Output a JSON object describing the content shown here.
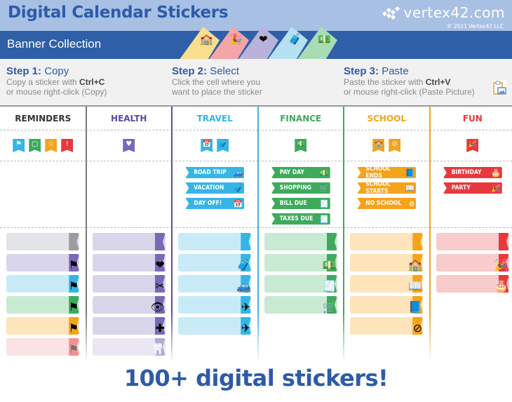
{
  "header": {
    "title": "Digital Calendar Stickers",
    "subtitle": "Banner Collection",
    "logo_text": "vertex42.com",
    "copyright": "© 2021 Vertex42 LLC",
    "tabs": [
      {
        "name": "school",
        "color": "#fadd8f",
        "corner": "#f4b400",
        "icon": "🏫"
      },
      {
        "name": "fun",
        "color": "#f3a5a7",
        "corner": "#e8383d",
        "icon": "🎉"
      },
      {
        "name": "health",
        "color": "#b9b3dc",
        "corner": "#7b68b8",
        "icon": "❤"
      },
      {
        "name": "travel",
        "color": "#b6e1f3",
        "corner": "#35b5e5",
        "icon": "🧳"
      },
      {
        "name": "finance",
        "color": "#a9dcb4",
        "corner": "#3eaa5c",
        "icon": "💵"
      }
    ]
  },
  "steps": [
    {
      "num": "Step 1:",
      "action": "Copy",
      "line1_pre": "Copy a sticker with ",
      "line1_key": "Ctrl+C",
      "line2": "or mouse right-click (Copy)"
    },
    {
      "num": "Step 2:",
      "action": "Select",
      "line1_pre": "Click the cell where you",
      "line1_key": "",
      "line2": "want to place the sticker"
    },
    {
      "num": "Step 3:",
      "action": "Paste",
      "line1_pre": "Paste the sticker with ",
      "line1_key": "Ctrl+V",
      "line2": "or mouse right-click (Paste Picture)"
    }
  ],
  "paste_icon": "paste-picture-icon",
  "columns": [
    {
      "name": "REMINDERS",
      "color": "#333333",
      "line_color": "#777777",
      "ribbons": [
        {
          "color": "#35b5e5",
          "icon": "⚑"
        },
        {
          "color": "#3eaa5c",
          "icon": "▢"
        },
        {
          "color": "#f5a31a",
          "icon": "☆"
        },
        {
          "color": "#e8383d",
          "icon": "!"
        }
      ],
      "labels": [],
      "banners": [
        {
          "bg": "#e2e4e8",
          "end": "#9a9ca0",
          "icon": ""
        },
        {
          "bg": "#d9d5ea",
          "end": "#7b68b8",
          "icon": "⚑"
        },
        {
          "bg": "#c9ebf8",
          "end": "#35b5e5",
          "icon": "⚑"
        },
        {
          "bg": "#c9ead2",
          "end": "#3eaa5c",
          "icon": "⚑"
        },
        {
          "bg": "#fde4bb",
          "end": "#f5a31a",
          "icon": "⚑"
        },
        {
          "bg": "#f8cccd",
          "end": "#e8383d",
          "icon": "⚑",
          "fade": true
        }
      ]
    },
    {
      "name": "HEALTH",
      "color": "#5b4ba0",
      "line_color": "#5b4ba0",
      "ribbons": [
        {
          "color": "#7b68b8",
          "icon": "♥"
        }
      ],
      "labels": [],
      "banners": [
        {
          "bg": "#d9d5ea",
          "end": "#7b68b8",
          "icon": ""
        },
        {
          "bg": "#d9d5ea",
          "end": "#7b68b8",
          "icon": "❤"
        },
        {
          "bg": "#d9d5ea",
          "end": "#7b68b8",
          "icon": "✂"
        },
        {
          "bg": "#d9d5ea",
          "end": "#7b68b8",
          "icon": "👁"
        },
        {
          "bg": "#d9d5ea",
          "end": "#7b68b8",
          "icon": "✚"
        },
        {
          "bg": "#d9d5ea",
          "end": "#7b68b8",
          "icon": "🦷",
          "fade": true
        }
      ]
    },
    {
      "name": "TRAVEL",
      "color": "#35b5e5",
      "line_color": "#35b5e5",
      "ribbons": [
        {
          "color": "#35b5e5",
          "icon": "📅"
        },
        {
          "color": "#35b5e5",
          "icon": "🧳"
        }
      ],
      "labels": [
        {
          "text": "ROAD TRIP",
          "icon": "🚙"
        },
        {
          "text": "VACATION",
          "icon": "🧳"
        },
        {
          "text": "DAY OFF!",
          "icon": "📅"
        }
      ],
      "label_color": "#35b5e5",
      "banners": [
        {
          "bg": "#c9ebf8",
          "end": "#35b5e5",
          "icon": ""
        },
        {
          "bg": "#c9ebf8",
          "end": "#35b5e5",
          "icon": "🧳"
        },
        {
          "bg": "#c9ebf8",
          "end": "#35b5e5",
          "icon": "🚙"
        },
        {
          "bg": "#c9ebf8",
          "end": "#35b5e5",
          "icon": "✈"
        },
        {
          "bg": "#c9ebf8",
          "end": "#35b5e5",
          "icon": "✈"
        }
      ]
    },
    {
      "name": "FINANCE",
      "color": "#3eaa5c",
      "line_color": "#3eaa5c",
      "ribbons": [
        {
          "color": "#3eaa5c",
          "icon": "💵"
        }
      ],
      "labels": [
        {
          "text": "PAY DAY",
          "icon": "💵"
        },
        {
          "text": "SHOPPING",
          "icon": "🛒"
        },
        {
          "text": "BILL DUE",
          "icon": "🧾"
        },
        {
          "text": "TAXES DUE",
          "icon": "🧾"
        }
      ],
      "label_color": "#3eaa5c",
      "banners": [
        {
          "bg": "#c9ead2",
          "end": "#3eaa5c",
          "icon": ""
        },
        {
          "bg": "#c9ead2",
          "end": "#3eaa5c",
          "icon": "💵"
        },
        {
          "bg": "#c9ead2",
          "end": "#3eaa5c",
          "icon": "🧾"
        },
        {
          "bg": "#c9ead2",
          "end": "#3eaa5c",
          "icon": "🛒"
        }
      ]
    },
    {
      "name": "SCHOOL",
      "color": "#f5a31a",
      "line_color": "#f5a31a",
      "ribbons": [
        {
          "color": "#f5a31a",
          "icon": "🏫"
        },
        {
          "color": "#f5a31a",
          "icon": "⊘"
        }
      ],
      "labels": [
        {
          "text": "SCHOOL ENDS",
          "icon": "📘"
        },
        {
          "text": "SCHOOL STARTS",
          "icon": "📖"
        },
        {
          "text": "NO SCHOOL",
          "icon": "⊘"
        }
      ],
      "label_color": "#f5a31a",
      "banners": [
        {
          "bg": "#fde4bb",
          "end": "#f5a31a",
          "icon": ""
        },
        {
          "bg": "#fde4bb",
          "end": "#f5a31a",
          "icon": "🏫"
        },
        {
          "bg": "#fde4bb",
          "end": "#f5a31a",
          "icon": "📖"
        },
        {
          "bg": "#fde4bb",
          "end": "#f5a31a",
          "icon": "📘"
        },
        {
          "bg": "#fde4bb",
          "end": "#f5a31a",
          "icon": "⊘"
        }
      ]
    },
    {
      "name": "FUN",
      "color": "#e8383d",
      "line_color": "#e8383d",
      "ribbons": [
        {
          "color": "#e8383d",
          "icon": "🎉"
        }
      ],
      "labels": [
        {
          "text": "BIRTHDAY",
          "icon": "🎂"
        },
        {
          "text": "PARTY",
          "icon": "🎉"
        }
      ],
      "label_color": "#e8383d",
      "banners": [
        {
          "bg": "#f8cccd",
          "end": "#e8383d",
          "icon": ""
        },
        {
          "bg": "#f8cccd",
          "end": "#e8383d",
          "icon": "🎉"
        },
        {
          "bg": "#f8cccd",
          "end": "#e8383d",
          "icon": "🎂"
        }
      ]
    }
  ],
  "tagline": "100+ digital stickers!"
}
